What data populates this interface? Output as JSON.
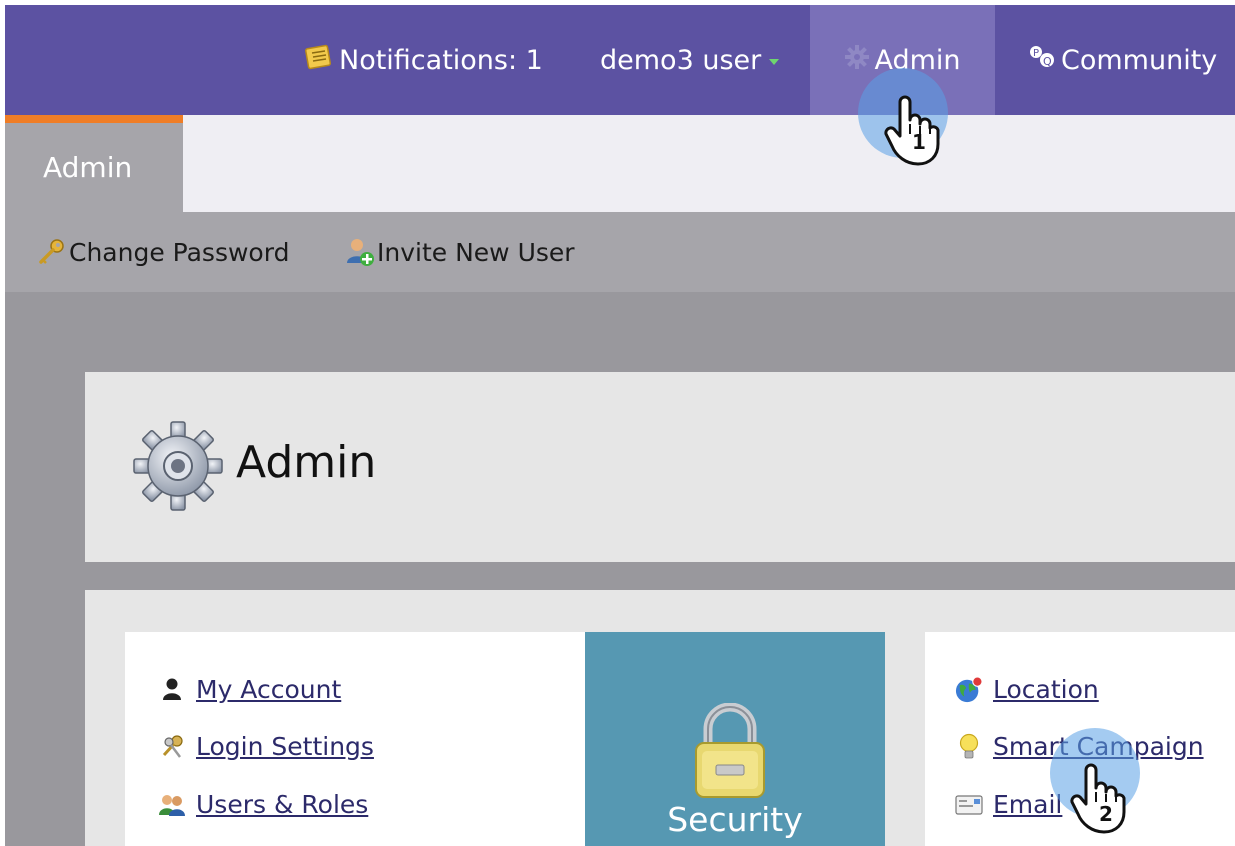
{
  "topnav": {
    "notifications_label": "Notifications: 1",
    "user_label": "demo3 user",
    "admin_label": "Admin",
    "community_label": "Community"
  },
  "tabs": [
    {
      "label": "Admin",
      "active": true
    }
  ],
  "actions": {
    "change_password": "Change Password",
    "invite_new_user": "Invite New User"
  },
  "page": {
    "title": "Admin"
  },
  "left_links": [
    {
      "label": "My Account",
      "icon": "person-icon"
    },
    {
      "label": "Login Settings",
      "icon": "keys-icon"
    },
    {
      "label": "Users & Roles",
      "icon": "users-icon"
    }
  ],
  "security_card": {
    "label": "Security",
    "icon": "padlock-icon"
  },
  "right_links": [
    {
      "label": "Location",
      "icon": "globe-icon"
    },
    {
      "label": "Smart Campaign",
      "icon": "lightbulb-icon"
    },
    {
      "label": "Email",
      "icon": "email-icon"
    }
  ],
  "annotations": {
    "step1": "1",
    "step2": "2"
  },
  "colors": {
    "topbar": "#5c52a2",
    "active_nav": "#7a70b8",
    "tab_accent": "#ef7d26",
    "security_card": "#5698b2",
    "link": "#2c2a6a"
  }
}
